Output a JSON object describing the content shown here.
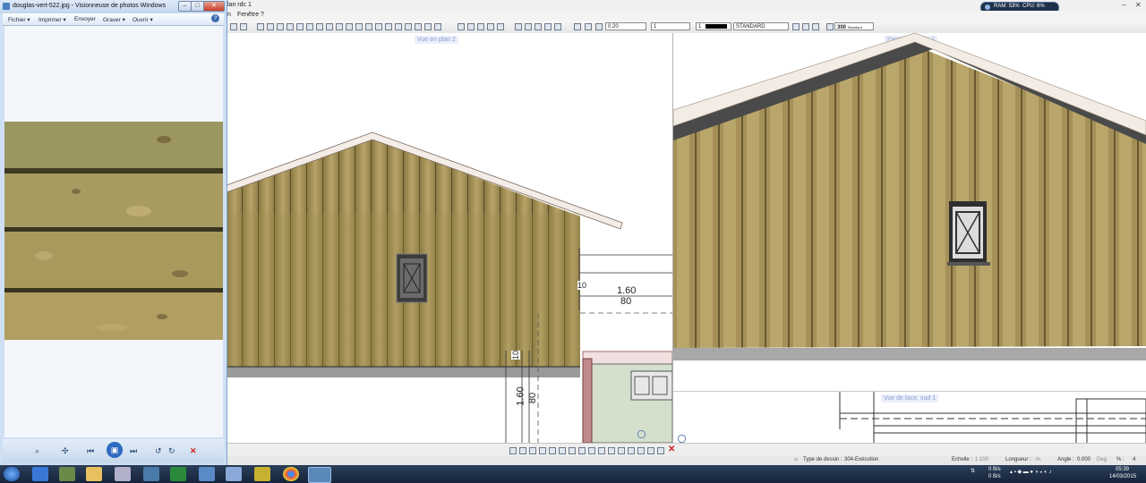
{
  "viewer": {
    "title": "douglas-vert-522.jpg - Visionneuse de photos Windows",
    "menu": [
      "Fichier",
      "Imprimer",
      "Envoyer",
      "Graver",
      "Ouvrir"
    ],
    "help": "?",
    "controls": {
      "zoom": "⌕",
      "fit": "✣",
      "prev": "⏮",
      "slideshow": "▣",
      "next": "⏭",
      "rotate_left": "↺",
      "rotate_right": "↻",
      "delete": "✕"
    },
    "window_buttons": {
      "minimize": "–",
      "maximize": "□",
      "close": "✕"
    }
  },
  "cad": {
    "title_fragment": "lan rdc 1",
    "menu": [
      "n",
      "Fenêtre",
      "?"
    ],
    "toolbar": {
      "pen_width": "0.20",
      "line_type": "1",
      "color_index": "1",
      "layer": "STANDARD",
      "scale": "300",
      "scale_label": "Standard"
    },
    "views": {
      "plan": "Vue en plan 2",
      "perspective": "Persp. centrale 3",
      "face": "Vue de face, sud 1"
    },
    "dimensions": {
      "d1": "10",
      "d2": "1.60",
      "d3": "80",
      "d4": "10",
      "d5": "1.60",
      "d6": "80"
    },
    "status": {
      "drawing_type_label": "Type de dessin :",
      "drawing_type": "304-Exécution",
      "scale_label": "Echelle :",
      "scale_value": "1:100",
      "length_label": "Longueur :",
      "length_unit": "m",
      "angle_label": "Angle :",
      "angle_value": "0.000",
      "angle_unit": "Deg",
      "percent_label": "% :",
      "percent_value": "4"
    }
  },
  "system": {
    "ram": "RAM: 53%",
    "cpu": "CPU: 6%",
    "net_up": "0 B/s",
    "net_down": "0 B/s",
    "time": "05:39",
    "date": "14/03/2015"
  },
  "colors": {
    "wood_light": "#b9a468",
    "wood_dark": "#7f6d3c",
    "roof_trim": "#f4ece6",
    "taskbar": "#1b2b44",
    "delete_red": "#d02020"
  }
}
